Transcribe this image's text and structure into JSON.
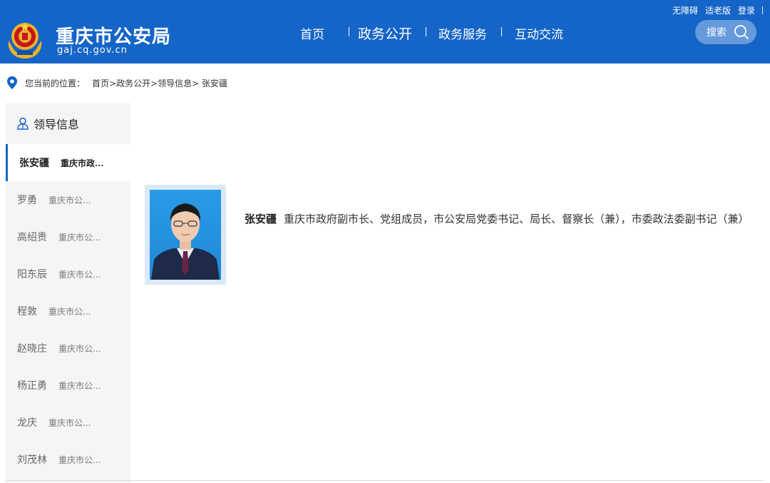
{
  "header": {
    "site_title": "重庆市公安局",
    "site_domain": "gaj.cq.gov.cn",
    "top_links": [
      "无障碍",
      "适老版",
      "登录"
    ],
    "nav": [
      "首页",
      "政务公开",
      "政务服务",
      "互动交流"
    ],
    "active_nav_index": 1,
    "search_label": "搜索",
    "brand_color": "#1565c8"
  },
  "breadcrumb": {
    "prefix": "您当前的位置：",
    "items": [
      "首页",
      ">政务公开",
      ">领导信息",
      "> 张安疆"
    ]
  },
  "sidebar": {
    "title": "领导信息",
    "items": [
      {
        "name": "张安疆",
        "title": "重庆市政...",
        "active": true
      },
      {
        "name": "罗勇",
        "title": "重庆市公..."
      },
      {
        "name": "高绍贵",
        "title": "重庆市公..."
      },
      {
        "name": "阳东辰",
        "title": "重庆市公..."
      },
      {
        "name": "程敦",
        "title": "重庆市公..."
      },
      {
        "name": "赵晓庄",
        "title": "重庆市公..."
      },
      {
        "name": "杨正勇",
        "title": "重庆市公..."
      },
      {
        "name": "龙庆",
        "title": "重庆市公..."
      },
      {
        "name": "刘茂林",
        "title": "重庆市公..."
      }
    ]
  },
  "leader": {
    "name": "张安疆",
    "description": "重庆市政府副市长、党组成员，市公安局党委书记、局长、督察长（兼），市委政法委副书记（兼）"
  }
}
